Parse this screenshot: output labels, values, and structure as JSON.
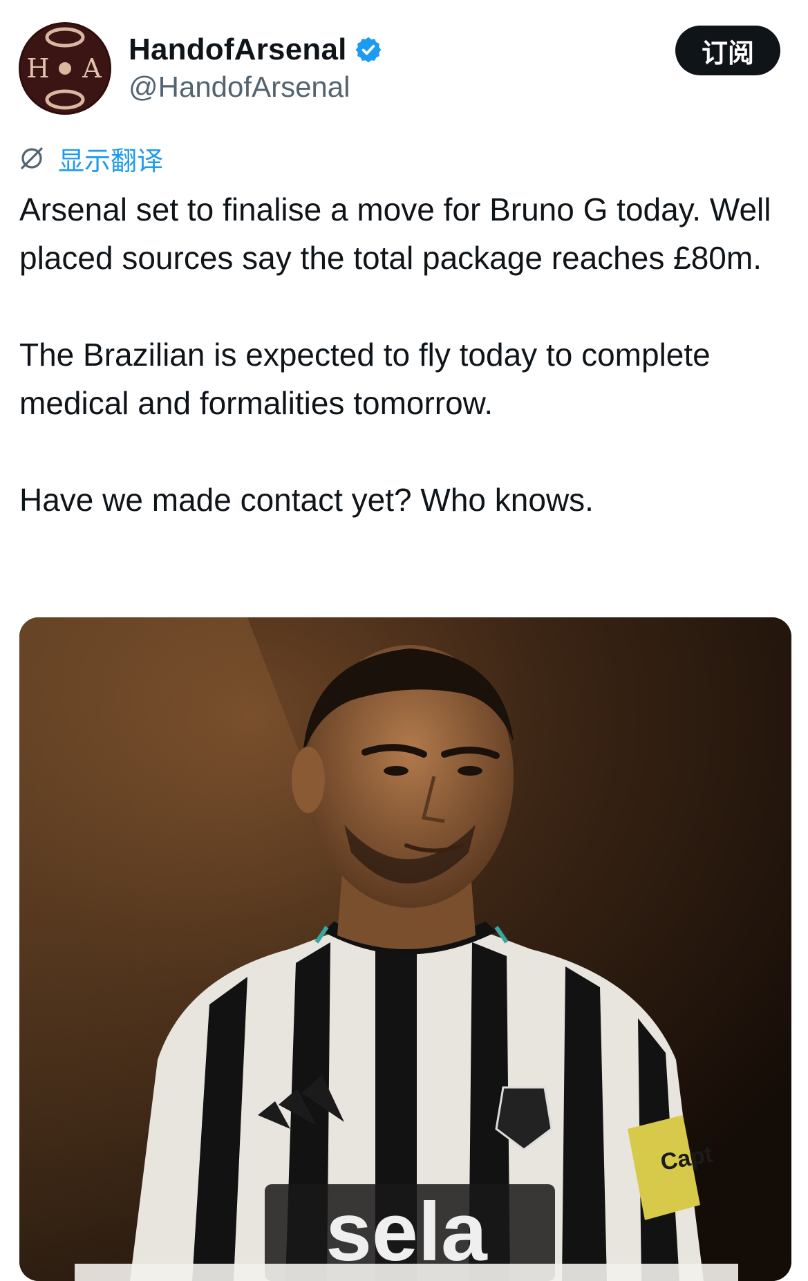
{
  "tweet": {
    "display_name": "HandofArsenal",
    "handle": "@HandofArsenal",
    "subscribe_label": "订阅",
    "translate_label": "显示翻译",
    "paragraphs": [
      "Arsenal set to finalise a move for Bruno G today. Well placed sources say the total package reaches £80m.",
      "The Brazilian is expected to fly today to complete medical and formalities tomorrow.",
      "Have we made contact yet? Who knows."
    ]
  },
  "avatar": {
    "letters": "H A"
  },
  "media": {
    "sponsor_text": "sela",
    "armband_text": "Capt"
  },
  "colors": {
    "accent": "#1d9bf0",
    "text": "#0f1419",
    "secondary": "#536471",
    "button_bg": "#0f1419"
  },
  "icons": {
    "verified": "verified-badge-icon",
    "translate": "globe-translate-icon"
  }
}
